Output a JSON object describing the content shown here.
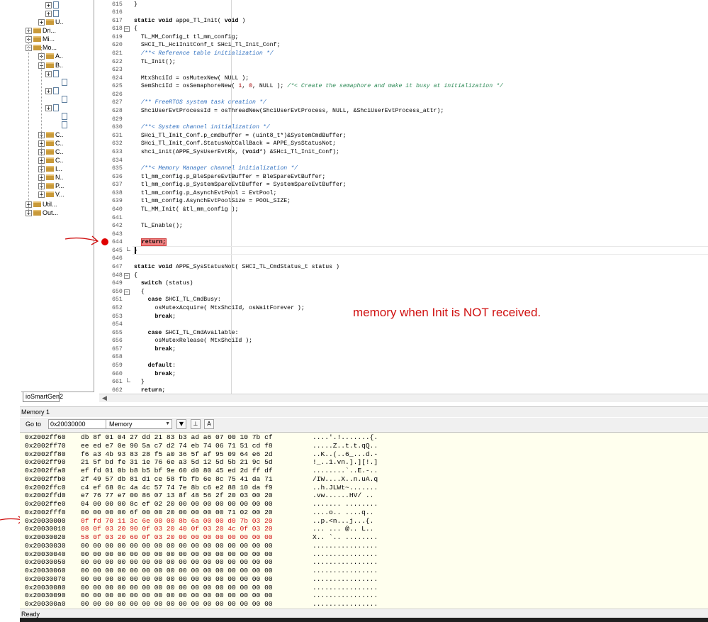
{
  "tree": {
    "items": [
      {
        "label": "",
        "expander": "+",
        "kind": "file"
      },
      {
        "label": "",
        "expander": "+",
        "kind": "file"
      },
      {
        "label": "U..",
        "expander": "+",
        "kind": "folder"
      },
      {
        "label": "Dri...",
        "expander": "+",
        "kind": "folder"
      },
      {
        "label": "Mi...",
        "expander": "+",
        "kind": "folder"
      },
      {
        "label": "Mo...",
        "expander": "−",
        "kind": "folder"
      },
      {
        "label": "A..",
        "expander": "+",
        "kind": "folder"
      },
      {
        "label": "B..",
        "expander": "−",
        "kind": "folder"
      },
      {
        "label": "",
        "expander": "+",
        "kind": "file"
      },
      {
        "label": "",
        "expander": "",
        "kind": "file"
      },
      {
        "label": "",
        "expander": "+",
        "kind": "file"
      },
      {
        "label": "",
        "expander": "",
        "kind": "file"
      },
      {
        "label": "",
        "expander": "+",
        "kind": "file"
      },
      {
        "label": "",
        "expander": "",
        "kind": "file"
      },
      {
        "label": "",
        "expander": "",
        "kind": "file"
      },
      {
        "label": "C..",
        "expander": "+",
        "kind": "folder"
      },
      {
        "label": "C..",
        "expander": "+",
        "kind": "folder"
      },
      {
        "label": "C..",
        "expander": "+",
        "kind": "folder"
      },
      {
        "label": "C..",
        "expander": "+",
        "kind": "folder"
      },
      {
        "label": "I...",
        "expander": "+",
        "kind": "folder"
      },
      {
        "label": "N..",
        "expander": "+",
        "kind": "folder"
      },
      {
        "label": "P...",
        "expander": "+",
        "kind": "folder"
      },
      {
        "label": "V...",
        "expander": "+",
        "kind": "folder"
      },
      {
        "label": "Util...",
        "expander": "+",
        "kind": "folder"
      },
      {
        "label": "Out...",
        "expander": "+",
        "kind": "folder"
      }
    ],
    "project_tab": "ioSmartGen2"
  },
  "editor": {
    "annotation": "memory when Init is NOT received.",
    "lines": [
      {
        "n": "615",
        "html": "}"
      },
      {
        "n": "616",
        "html": ""
      },
      {
        "n": "617",
        "html": "<span class=\"kw\">static void</span> appe_Tl_Init( <span class=\"kw\">void</span> )"
      },
      {
        "n": "618",
        "html": "{",
        "fold": "open"
      },
      {
        "n": "619",
        "html": "  TL_MM_Config_t tl_mm_config;"
      },
      {
        "n": "620",
        "html": "  SHCI_TL_HciInitConf_t SHci_Tl_Init_Conf;"
      },
      {
        "n": "621",
        "html": "  <span class=\"cmb\">/**&lt; Reference table initialization */</span>"
      },
      {
        "n": "622",
        "html": "  TL_Init();"
      },
      {
        "n": "623",
        "html": ""
      },
      {
        "n": "624",
        "html": "  MtxShciId = osMutexNew( NULL );"
      },
      {
        "n": "625",
        "html": "  SemShciId = osSemaphoreNew( <span class=\"num\">1</span>, <span class=\"num\">0</span>, NULL ); <span class=\"cm\">/*&lt; Create the semaphore and make it busy at initialization */</span>"
      },
      {
        "n": "626",
        "html": ""
      },
      {
        "n": "627",
        "html": "  <span class=\"cmb\">/** FreeRTOS system task creation */</span>"
      },
      {
        "n": "628",
        "html": "  ShciUserEvtProcessId = osThreadNew(ShciUserEvtProcess, NULL, &amp;ShciUserEvtProcess_attr);"
      },
      {
        "n": "629",
        "html": ""
      },
      {
        "n": "630",
        "html": "  <span class=\"cmb\">/**&lt; System channel initialization */</span>"
      },
      {
        "n": "631",
        "html": "  SHci_Tl_Init_Conf.p_cmdbuffer = (uint8_t*)&amp;SystemCmdBuffer;"
      },
      {
        "n": "632",
        "html": "  SHci_Tl_Init_Conf.StatusNotCallBack = APPE_SysStatusNot;"
      },
      {
        "n": "633",
        "html": "  shci_init(APPE_SysUserEvtRx, (<span class=\"kw\">void</span>*) &amp;SHci_Tl_Init_Conf);"
      },
      {
        "n": "634",
        "html": ""
      },
      {
        "n": "635",
        "html": "  <span class=\"cmb\">/**&lt; Memory Manager channel initialization */</span>"
      },
      {
        "n": "636",
        "html": "  tl_mm_config.p_BleSpareEvtBuffer = BleSpareEvtBuffer;"
      },
      {
        "n": "637",
        "html": "  tl_mm_config.p_SystemSpareEvtBuffer = SystemSpareEvtBuffer;"
      },
      {
        "n": "638",
        "html": "  tl_mm_config.p_AsynchEvtPool = EvtPool;"
      },
      {
        "n": "639",
        "html": "  tl_mm_config.AsynchEvtPoolSize = POOL_SIZE;"
      },
      {
        "n": "640",
        "html": "  TL_MM_Init( &amp;tl_mm_config );"
      },
      {
        "n": "641",
        "html": ""
      },
      {
        "n": "642",
        "html": "  TL_Enable();"
      },
      {
        "n": "643",
        "html": ""
      },
      {
        "n": "644",
        "html": "  <span class=\"retbox\">return;</span>"
      },
      {
        "n": "645",
        "html": "}",
        "fold": "end"
      },
      {
        "n": "646",
        "html": ""
      },
      {
        "n": "647",
        "html": "<span class=\"kw\">static void</span> APPE_SysStatusNot( SHCI_TL_CmdStatus_t status )"
      },
      {
        "n": "648",
        "html": "{",
        "fold": "open"
      },
      {
        "n": "649",
        "html": "  <span class=\"kw\">switch</span> (status)"
      },
      {
        "n": "650",
        "html": "  {",
        "fold": "open"
      },
      {
        "n": "651",
        "html": "    <span class=\"kw\">case</span> SHCI_TL_CmdBusy:"
      },
      {
        "n": "652",
        "html": "      osMutexAcquire( MtxShciId, osWaitForever );"
      },
      {
        "n": "653",
        "html": "      <span class=\"kw\">break</span>;"
      },
      {
        "n": "654",
        "html": ""
      },
      {
        "n": "655",
        "html": "    <span class=\"kw\">case</span> SHCI_TL_CmdAvailable:"
      },
      {
        "n": "656",
        "html": "      osMutexRelease( MtxShciId );"
      },
      {
        "n": "657",
        "html": "      <span class=\"kw\">break</span>;"
      },
      {
        "n": "658",
        "html": ""
      },
      {
        "n": "659",
        "html": "    <span class=\"kw\">default</span>:"
      },
      {
        "n": "660",
        "html": "      <span class=\"kw\">break</span>;"
      },
      {
        "n": "661",
        "html": "  }",
        "fold": "end"
      },
      {
        "n": "662",
        "html": "  <span class=\"kw\">return</span>;"
      }
    ]
  },
  "memory": {
    "title": "Memory 1",
    "goto_label": "Go to",
    "goto_value": "0x20030000",
    "zone": "Memory",
    "rows": [
      {
        "addr": "0x2002ff60",
        "bytes": "db 8f 01 04 27 dd 21 83 b3 ad a6 07 00 10 7b cf",
        "ascii": "....'.!.......{."
      },
      {
        "addr": "0x2002ff70",
        "bytes": "ee ed e7 0e 90 5a c7 d2 74 eb 74 06 71 51 cd f8",
        "ascii": ".....Z..t.t.qQ.."
      },
      {
        "addr": "0x2002ff80",
        "bytes": "f6 a3 4b 93 83 28 f5 a0 36 5f af 95 09 64 e6 2d",
        "ascii": "..K..(..6_...d.-"
      },
      {
        "addr": "0x2002ff90",
        "bytes": "21 5f bd fe 31 1e 76 6e a3 5d 12 5d 5b 21 9c 5d",
        "ascii": "!_..1.vn.].][!.]"
      },
      {
        "addr": "0x2002ffa0",
        "bytes": "ef fd 01 0b b8 b5 bf 9e 60 d0 80 45 ed 2d ff df",
        "ascii": "........`..E.-.."
      },
      {
        "addr": "0x2002ffb0",
        "bytes": "2f 49 57 db 81 d1 ce 58 fb fb 6e 8c 75 41 da 71",
        "ascii": "/IW....X..n.uA.q"
      },
      {
        "addr": "0x2002ffc0",
        "bytes": "c4 ef 68 0c 4a 4c 57 74 7e 8b c6 e2 88 10 da f9",
        "ascii": "..h.JLWt~......."
      },
      {
        "addr": "0x2002ffd0",
        "bytes": "e7 76 77 e7 00 86 07 13 8f 48 56 2f 20 03 00 20",
        "ascii": ".vw......HV/ .. "
      },
      {
        "addr": "0x2002ffe0",
        "bytes": "04 00 00 00 8c ef 02 20 00 00 00 00 00 00 00 00",
        "ascii": "....... ........"
      },
      {
        "addr": "0x2002fff0",
        "bytes": "00 00 00 00 6f 00 00 20 00 00 00 00 71 02 00 20",
        "ascii": "....o.. ....q.. "
      },
      {
        "addr": "0x20030000",
        "bytes": "0f fd 70 11 3c 6e 00 00 8b 6a 00 00 d0 7b 03 20",
        "ascii": "..p.<n...j...{. ",
        "hl": true
      },
      {
        "addr": "0x20030010",
        "bytes": "08 0f 03 20 90 0f 03 20 40 0f 03 20 4c 0f 03 20",
        "ascii": "... ... @.. L.. ",
        "hl": true
      },
      {
        "addr": "0x20030020",
        "bytes": "58 0f 03 20 60 0f 03 20 00 00 00 00 00 00 00 00",
        "ascii": "X.. `.. ........",
        "hl": true
      },
      {
        "addr": "0x20030030",
        "bytes": "00 00 00 00 00 00 00 00 00 00 00 00 00 00 00 00",
        "ascii": "................"
      },
      {
        "addr": "0x20030040",
        "bytes": "00 00 00 00 00 00 00 00 00 00 00 00 00 00 00 00",
        "ascii": "................"
      },
      {
        "addr": "0x20030050",
        "bytes": "00 00 00 00 00 00 00 00 00 00 00 00 00 00 00 00",
        "ascii": "................"
      },
      {
        "addr": "0x20030060",
        "bytes": "00 00 00 00 00 00 00 00 00 00 00 00 00 00 00 00",
        "ascii": "................"
      },
      {
        "addr": "0x20030070",
        "bytes": "00 00 00 00 00 00 00 00 00 00 00 00 00 00 00 00",
        "ascii": "................"
      },
      {
        "addr": "0x20030080",
        "bytes": "00 00 00 00 00 00 00 00 00 00 00 00 00 00 00 00",
        "ascii": "................"
      },
      {
        "addr": "0x20030090",
        "bytes": "00 00 00 00 00 00 00 00 00 00 00 00 00 00 00 00",
        "ascii": "................"
      },
      {
        "addr": "0x200300a0",
        "bytes": "00 00 00 00 00 00 00 00 00 00 00 00 00 00 00 00",
        "ascii": "................"
      }
    ]
  },
  "status": "Ready",
  "colors": {
    "annotation": "#d01010",
    "breakpoint": "#e00000",
    "memory_bg": "#ffffee"
  }
}
